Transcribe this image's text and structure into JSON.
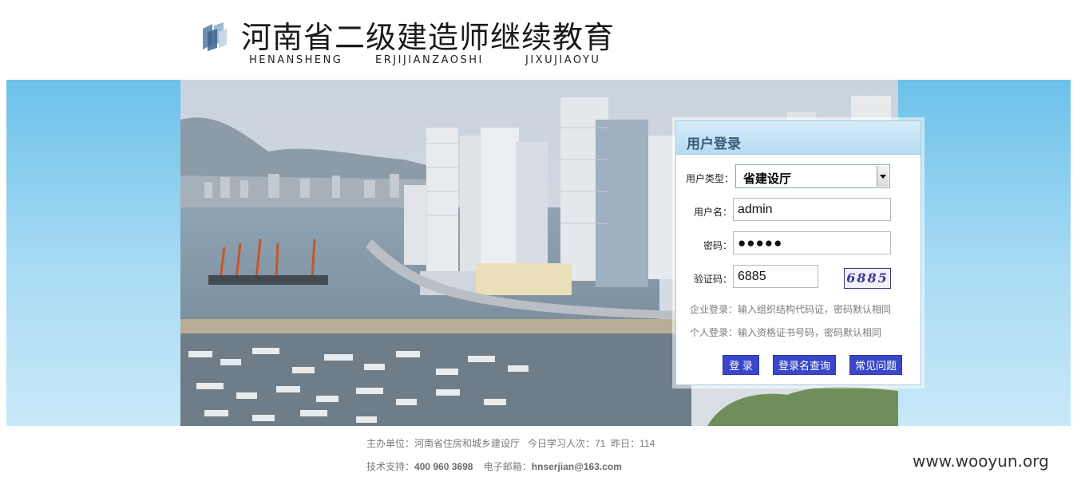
{
  "header": {
    "title": "河南省二级建造师继续教育",
    "pinyin": [
      "HENANSHENG",
      "ERJIJIANZAOSHI",
      "JIXUJIAOYU"
    ]
  },
  "login": {
    "title": "用户登录",
    "user_type_label": "用户类型：",
    "user_type_value": "省建设厅",
    "username_label": "用户名：",
    "username_value": "admin",
    "password_label": "密码：",
    "password_value": "●●●●●",
    "code_label": "验证码：",
    "code_value": "6885",
    "captcha_text": "6885",
    "hint_company": "企业登录：输入组织结构代码证，密码默认相同",
    "hint_personal": "个人登录：输入资格证书号码，密码默认相同",
    "buttons": {
      "login": "登 录",
      "query": "登录名查询",
      "faq": "常见问题"
    }
  },
  "footer": {
    "host_label": "主办单位：",
    "host_value": "河南省住房和城乡建设厅",
    "today_label": "今日学习人次：",
    "today_value": "71",
    "yesterday_label": "昨日：",
    "yesterday_value": "114",
    "support_label": "技术支持：",
    "support_phone": "400 960 3698",
    "email_label": "电子邮箱：",
    "email_value": "hnserjian@163.com"
  },
  "watermark": "www.wooyun.org",
  "colors": {
    "button": "#3b47c9",
    "banner_sky": "#6cc1ea",
    "panel_header": "#b7dbf1"
  }
}
